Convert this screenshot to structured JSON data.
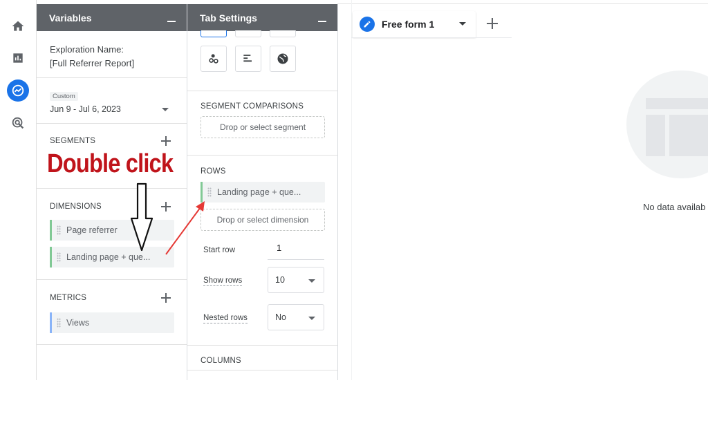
{
  "nav": {
    "items": [
      {
        "icon": "home-icon"
      },
      {
        "icon": "bar-chart-icon"
      },
      {
        "icon": "explore-icon",
        "active": true
      },
      {
        "icon": "advertising-icon"
      }
    ]
  },
  "variables_panel": {
    "title": "Variables",
    "exploration_label": "Exploration Name:",
    "exploration_name": "[Full Referrer Report]",
    "date_badge": "Custom",
    "date_range": "Jun 9 - Jul 6, 2023",
    "segments_label": "SEGMENTS",
    "dimensions_label": "DIMENSIONS",
    "dimensions": [
      {
        "label": "Page referrer"
      },
      {
        "label": "Landing page + que..."
      }
    ],
    "metrics_label": "METRICS",
    "metrics": [
      {
        "label": "Views"
      }
    ]
  },
  "tab_settings_panel": {
    "title": "Tab Settings",
    "segment_comparisons_label": "SEGMENT COMPARISONS",
    "segment_drop": "Drop or select segment",
    "rows_label": "ROWS",
    "row_chip": "Landing page + que...",
    "dimension_drop": "Drop or select dimension",
    "start_row_label": "Start row",
    "start_row_value": "1",
    "show_rows_label": "Show rows",
    "show_rows_value": "10",
    "nested_rows_label": "Nested rows",
    "nested_rows_value": "No",
    "columns_label": "COLUMNS"
  },
  "canvas": {
    "tab_label": "Free form 1",
    "no_data": "No data availab"
  },
  "annotation": {
    "text": "Double click",
    "color": "#c0141b"
  },
  "colors": {
    "header": "#5f6368",
    "accent": "#1a73e8",
    "dimension_bar": "#81c995",
    "metric_bar": "#8ab4f8"
  }
}
